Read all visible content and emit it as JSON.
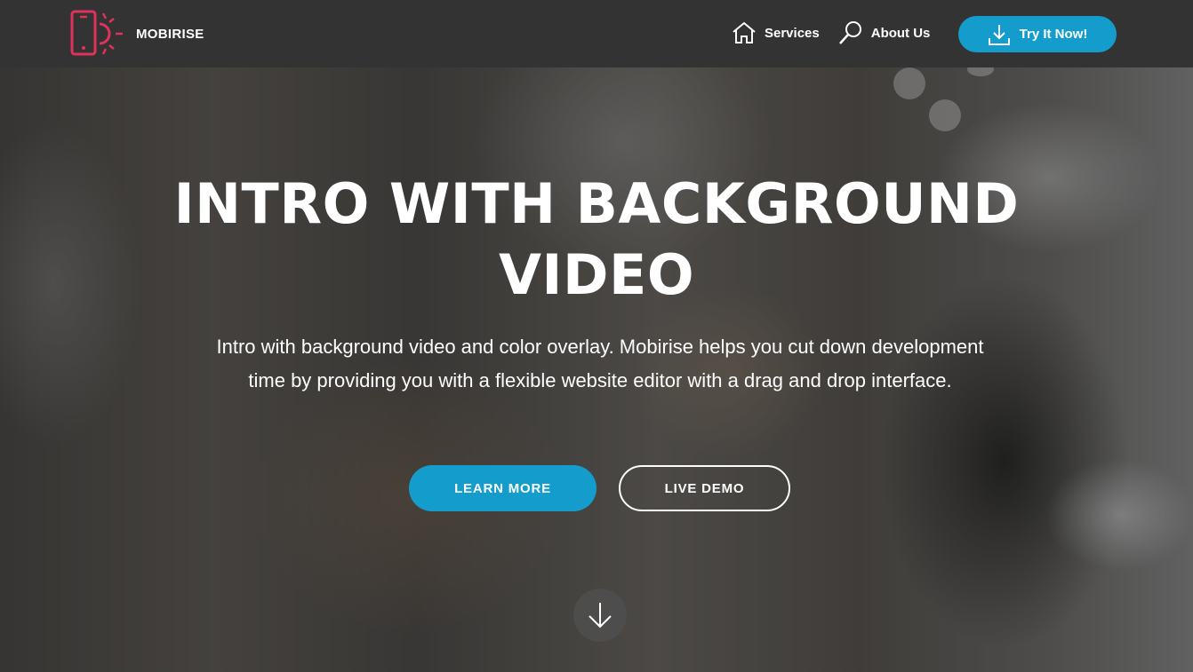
{
  "navbar": {
    "brand_name": "MOBIRISE",
    "logo_icon": "phone-sun-icon",
    "links": [
      {
        "label": "Services",
        "icon": "home-icon"
      },
      {
        "label": "About Us",
        "icon": "search-icon"
      }
    ],
    "cta": {
      "label": "Try It Now!",
      "icon": "download-icon"
    }
  },
  "hero": {
    "title": "INTRO WITH BACKGROUND VIDEO",
    "text": "Intro with background video and color overlay. Mobirise helps you cut down development time by providing you with a flexible website editor with a drag and drop interface.",
    "buttons": {
      "primary": "LEARN MORE",
      "secondary": "LIVE DEMO"
    },
    "scroll_icon": "arrow-down-icon"
  },
  "colors": {
    "navbar_bg": "#333333",
    "accent": "#149dcc",
    "logo_accent": "#e0325a"
  }
}
